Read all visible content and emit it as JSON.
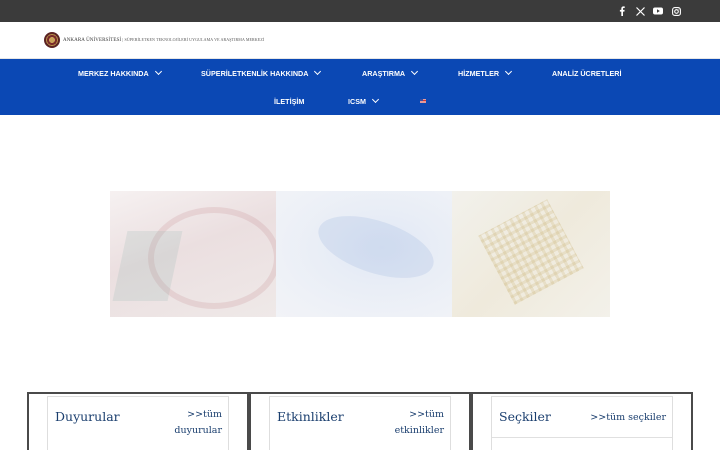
{
  "social": [
    {
      "name": "facebook-icon"
    },
    {
      "name": "x-icon"
    },
    {
      "name": "youtube-icon"
    },
    {
      "name": "instagram-icon"
    }
  ],
  "header": {
    "logo_text": "ANKARA ÜNİVERSİTESİ",
    "logo_sub": "| SÜPERİLETKEN TEKNOLOJİLERİ UYGULAMA VE ARAŞTIRMA MERKEZİ"
  },
  "nav": {
    "row1": [
      {
        "label": "MERKEZ HAKKINDA",
        "dropdown": true
      },
      {
        "label": "SÜPERİLETKENLİK HAKKINDA",
        "dropdown": true
      },
      {
        "label": "ARAŞTIRMA",
        "dropdown": true
      },
      {
        "label": "HİZMETLER",
        "dropdown": true
      },
      {
        "label": "ANALİZ ÜCRETLERİ",
        "dropdown": false
      }
    ],
    "row2": [
      {
        "label": "İLETİŞİM",
        "dropdown": false
      },
      {
        "label": "ICSM",
        "dropdown": true
      }
    ]
  },
  "panels": [
    {
      "title": "Duyurular",
      "link_line1": ">>tüm",
      "link_line2": "duyurular"
    },
    {
      "title": "Etkinlikler",
      "link_line1": ">>tüm",
      "link_line2": "etkinlikler"
    },
    {
      "title": "Seçkiler",
      "link_line1": ">>tüm seçkiler",
      "link_line2": ""
    }
  ],
  "colors": {
    "topbar": "#3b3b3b",
    "nav": "#0b48b4",
    "panel_title": "#1a3e6e"
  }
}
